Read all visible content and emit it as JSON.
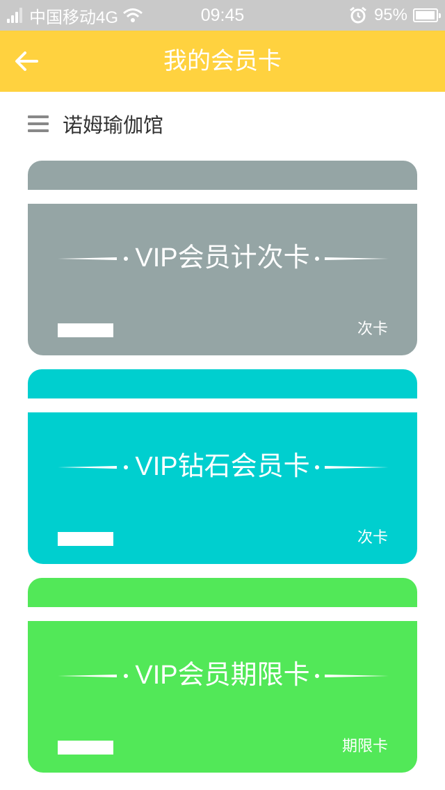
{
  "status_bar": {
    "carrier": "中国移动4G",
    "time": "09:45",
    "battery": "95%",
    "battery_level": 0.95,
    "icons": [
      "signal-icon",
      "wifi-icon",
      "alarm-icon",
      "battery-icon"
    ]
  },
  "header": {
    "title": "我的会员卡",
    "back_icon": "arrow-left-icon",
    "background": "#ffd23f"
  },
  "store": {
    "menu_icon": "menu-icon",
    "name": "诺姆瑜伽馆"
  },
  "cards": [
    {
      "title": "VIP会员计次卡",
      "type": "次卡",
      "color": "#95a5a5"
    },
    {
      "title": "VIP钻石会员卡",
      "type": "次卡",
      "color": "#00cfcf"
    },
    {
      "title": "VIP会员期限卡",
      "type": "期限卡",
      "color": "#52e858"
    }
  ]
}
